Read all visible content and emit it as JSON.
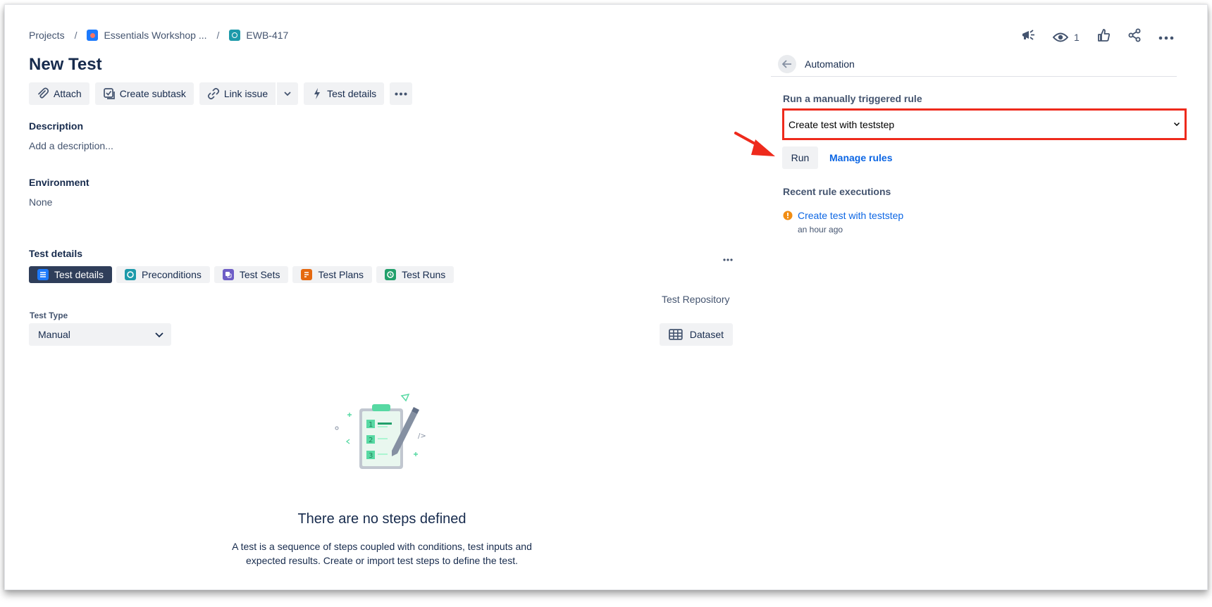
{
  "breadcrumb": {
    "projects": "Projects",
    "project_name": "Essentials Workshop ...",
    "issue_key": "EWB-417"
  },
  "issue": {
    "title": "New Test"
  },
  "toolbar": {
    "attach": "Attach",
    "create_subtask": "Create subtask",
    "link_issue": "Link issue",
    "test_details": "Test details"
  },
  "fields": {
    "description_label": "Description",
    "description_placeholder": "Add a description...",
    "environment_label": "Environment",
    "environment_value": "None"
  },
  "test_section": {
    "heading": "Test details",
    "tabs": [
      {
        "label": "Test details",
        "icon": "list-icon",
        "color": "#1d7afc"
      },
      {
        "label": "Preconditions",
        "icon": "precondition-icon",
        "color": "#1d9aaa"
      },
      {
        "label": "Test Sets",
        "icon": "test-set-icon",
        "color": "#6e5dc6"
      },
      {
        "label": "Test Plans",
        "icon": "test-plan-icon",
        "color": "#e56910"
      },
      {
        "label": "Test Runs",
        "icon": "test-run-icon",
        "color": "#22a06b"
      }
    ],
    "test_repository": "Test Repository",
    "test_type_label": "Test Type",
    "test_type_value": "Manual",
    "dataset": "Dataset",
    "empty_title": "There are no steps defined",
    "empty_desc_line1": "A test is a sequence of steps coupled with conditions, test inputs and",
    "empty_desc_line2": "expected results. Create or import test steps to define the test."
  },
  "header_actions": {
    "watch_count": "1"
  },
  "automation": {
    "title": "Automation",
    "run_label": "Run a manually triggered rule",
    "selected_rule": "Create test with teststep",
    "run_button": "Run",
    "manage_rules": "Manage rules",
    "recent_label": "Recent rule executions",
    "recent_item": "Create test with teststep",
    "recent_time": "an hour ago",
    "warning_color": "#f18d13",
    "highlight_color": "#ee2a1c"
  }
}
